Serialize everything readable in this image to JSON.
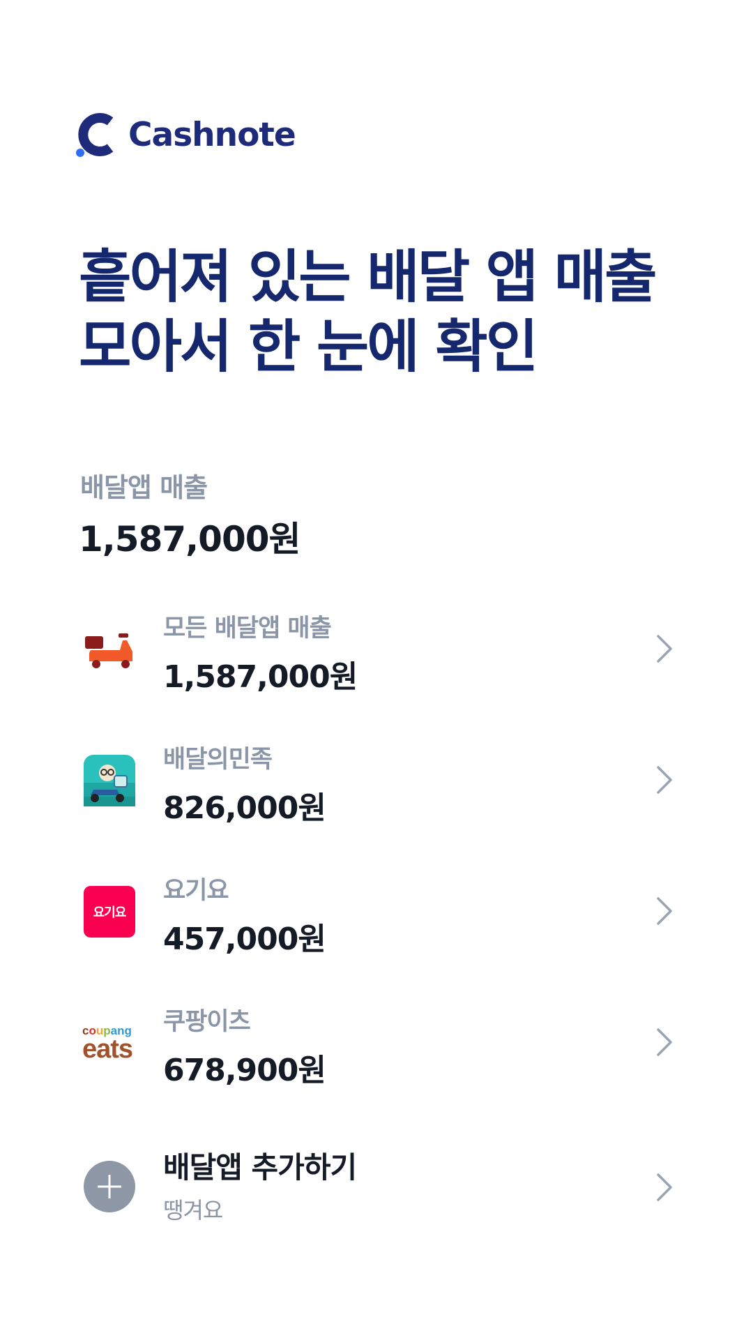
{
  "brand": {
    "name": "Cashnote",
    "color": "#1d2b7a",
    "accent": "#2f6df6"
  },
  "headline": {
    "line1": "흩어져 있는 배달 앱 매출",
    "line2": "모아서 한 눈에 확인"
  },
  "summary": {
    "label": "배달앱 매출",
    "amount": "1,587,000원"
  },
  "apps": [
    {
      "name": "모든 배달앱 매출",
      "amount": "1,587,000원",
      "icon": "scooter-icon"
    },
    {
      "name": "배달의민족",
      "amount": "826,000원",
      "icon": "baemin-app-icon"
    },
    {
      "name": "요기요",
      "amount": "457,000원",
      "icon": "yogiyo-app-icon",
      "icon_text": "요기요"
    },
    {
      "name": "쿠팡이츠",
      "amount": "678,900원",
      "icon": "coupang-eats-logo",
      "icon_text_small": "coupang",
      "icon_text_big": "eats"
    }
  ],
  "add": {
    "title": "배달앱 추가하기",
    "subtitle": "땡겨요",
    "icon": "plus-icon"
  }
}
